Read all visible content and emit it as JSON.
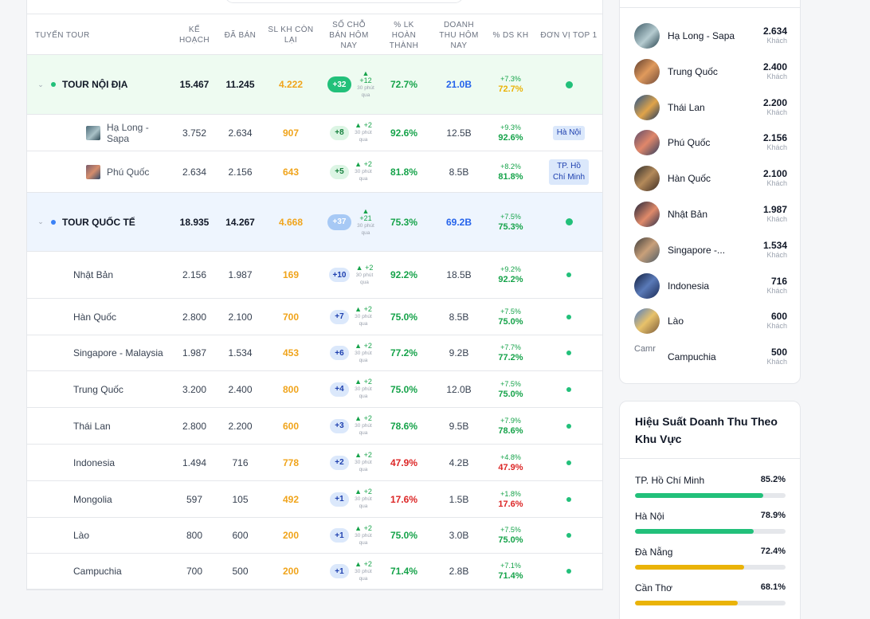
{
  "colors": {
    "green": "#22c07a",
    "blue": "#3b82f6",
    "orange": "#f0a41b",
    "red": "#dc2626",
    "amber": "#eab308"
  },
  "table": {
    "headers": {
      "route": "TUYẾN TOUR",
      "plan": "KẾ HOẠCH",
      "sold": "ĐÃ BÁN",
      "remaining": "SL KH CÒN LẠI",
      "today": "SỐ CHỖ BÁN HÔM NAY",
      "done": "% LK HOÀN THÀNH",
      "revenue": "DOANH THU HÔM NAY",
      "ds": "% DS KH",
      "unit": "ĐƠN VỊ TOP 1"
    },
    "groups": [
      {
        "name": "TOUR NỘI ĐỊA",
        "plan": "15.467",
        "sold": "11.245",
        "remaining": "4.222",
        "today": "+32",
        "delta": "+12",
        "delta_note": "30 phút qua",
        "done": "72.7%",
        "revenue": "21.0B",
        "ds_change": "+7.3%",
        "ds_pct": "72.7%",
        "dot_color": "#22c07a"
      },
      {
        "name": "TOUR QUỐC TẾ",
        "plan": "18.935",
        "sold": "14.267",
        "remaining": "4.668",
        "today": "+37",
        "delta": "+21",
        "delta_note": "30 phút qua",
        "done": "75.3%",
        "revenue": "69.2B",
        "ds_change": "+7.5%",
        "ds_pct": "75.3%",
        "dot_color": "#3b82f6"
      }
    ],
    "domestic_rows": [
      {
        "name": "Hạ Long - Sapa",
        "plan": "3.752",
        "sold": "2.634",
        "remaining": "907",
        "today": "+8",
        "delta": "+2",
        "delta_note": "30 phút qua",
        "done": "92.6%",
        "revenue": "12.5B",
        "ds_change": "+9.3%",
        "ds_pct": "92.6%",
        "unit": "Hà Nội"
      },
      {
        "name": "Phú Quốc",
        "plan": "2.634",
        "sold": "2.156",
        "remaining": "643",
        "today": "+5",
        "delta": "+2",
        "delta_note": "30 phút qua",
        "done": "81.8%",
        "revenue": "8.5B",
        "ds_change": "+8.2%",
        "ds_pct": "81.8%",
        "unit": "TP. Hồ Chí Minh"
      }
    ],
    "intl_rows": [
      {
        "name": "Nhật Bản",
        "plan": "2.156",
        "sold": "1.987",
        "remaining": "169",
        "today": "+10",
        "delta": "+2",
        "delta_note": "30 phút qua",
        "done": "92.2%",
        "revenue": "18.5B",
        "ds_change": "+9.2%",
        "ds_pct": "92.2%",
        "status": "good"
      },
      {
        "name": "Hàn Quốc",
        "plan": "2.800",
        "sold": "2.100",
        "remaining": "700",
        "today": "+7",
        "delta": "+2",
        "delta_note": "30 phút qua",
        "done": "75.0%",
        "revenue": "8.5B",
        "ds_change": "+7.5%",
        "ds_pct": "75.0%",
        "status": "good"
      },
      {
        "name": "Singapore - Malaysia",
        "plan": "1.987",
        "sold": "1.534",
        "remaining": "453",
        "today": "+6",
        "delta": "+2",
        "delta_note": "30 phút qua",
        "done": "77.2%",
        "revenue": "9.2B",
        "ds_change": "+7.7%",
        "ds_pct": "77.2%",
        "status": "good"
      },
      {
        "name": "Trung Quốc",
        "plan": "3.200",
        "sold": "2.400",
        "remaining": "800",
        "today": "+4",
        "delta": "+2",
        "delta_note": "30 phút qua",
        "done": "75.0%",
        "revenue": "12.0B",
        "ds_change": "+7.5%",
        "ds_pct": "75.0%",
        "status": "good"
      },
      {
        "name": "Thái Lan",
        "plan": "2.800",
        "sold": "2.200",
        "remaining": "600",
        "today": "+3",
        "delta": "+2",
        "delta_note": "30 phút qua",
        "done": "78.6%",
        "revenue": "9.5B",
        "ds_change": "+7.9%",
        "ds_pct": "78.6%",
        "status": "good"
      },
      {
        "name": "Indonesia",
        "plan": "1.494",
        "sold": "716",
        "remaining": "778",
        "today": "+2",
        "delta": "+2",
        "delta_note": "30 phút qua",
        "done": "47.9%",
        "revenue": "4.2B",
        "ds_change": "+4.8%",
        "ds_pct": "47.9%",
        "status": "bad"
      },
      {
        "name": "Mongolia",
        "plan": "597",
        "sold": "105",
        "remaining": "492",
        "today": "+1",
        "delta": "+2",
        "delta_note": "30 phút qua",
        "done": "17.6%",
        "revenue": "1.5B",
        "ds_change": "+1.8%",
        "ds_pct": "17.6%",
        "status": "bad"
      },
      {
        "name": "Lào",
        "plan": "800",
        "sold": "600",
        "remaining": "200",
        "today": "+1",
        "delta": "+2",
        "delta_note": "30 phút qua",
        "done": "75.0%",
        "revenue": "3.0B",
        "ds_change": "+7.5%",
        "ds_pct": "75.0%",
        "status": "good"
      },
      {
        "name": "Campuchia",
        "plan": "700",
        "sold": "500",
        "remaining": "200",
        "today": "+1",
        "delta": "+2",
        "delta_note": "30 phút qua",
        "done": "71.4%",
        "revenue": "2.8B",
        "ds_change": "+7.1%",
        "ds_pct": "71.4%",
        "status": "good"
      }
    ]
  },
  "top_destinations": {
    "unit_label": "Khách",
    "items": [
      {
        "name": "Hạ Long - Sapa",
        "value": "2.634"
      },
      {
        "name": "Trung Quốc",
        "value": "2.400"
      },
      {
        "name": "Thái Lan",
        "value": "2.200"
      },
      {
        "name": "Phú Quốc",
        "value": "2.156"
      },
      {
        "name": "Hàn Quốc",
        "value": "2.100"
      },
      {
        "name": "Nhật Bản",
        "value": "1.987"
      },
      {
        "name": "Singapore -...",
        "value": "1.534"
      },
      {
        "name": "Indonesia",
        "value": "716"
      },
      {
        "name": "Lào",
        "value": "600"
      },
      {
        "name": "Campuchia",
        "value": "500",
        "broken_alt": "Camr"
      }
    ]
  },
  "performance": {
    "title": "Hiệu Suất Doanh Thu Theo Khu Vực",
    "items": [
      {
        "label": "TP. Hồ Chí Minh",
        "value": "85.2%",
        "fraction": 0.852,
        "color": "#22c07a"
      },
      {
        "label": "Hà Nội",
        "value": "78.9%",
        "fraction": 0.789,
        "color": "#22c07a"
      },
      {
        "label": "Đà Nẵng",
        "value": "72.4%",
        "fraction": 0.724,
        "color": "#eab308"
      },
      {
        "label": "Cần Thơ",
        "value": "68.1%",
        "fraction": 0.681,
        "color": "#eab308"
      }
    ]
  }
}
